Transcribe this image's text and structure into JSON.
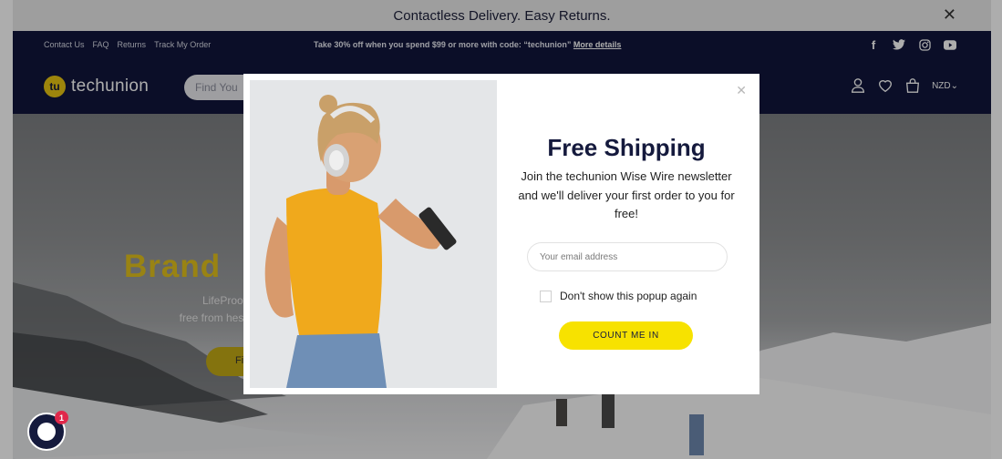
{
  "announcement": {
    "text": "Contactless Delivery. Easy Returns.",
    "close": "✕"
  },
  "utility_nav": {
    "links": [
      "Contact Us",
      "FAQ",
      "Returns",
      "Track My Order"
    ],
    "promo_text": "Take 30% off when you spend $99 or more with code: “techunion”",
    "promo_link": "More details",
    "social_icons": [
      "facebook-icon",
      "twitter-icon",
      "instagram-icon",
      "youtube-icon"
    ]
  },
  "header": {
    "logo_mark": "tu",
    "logo_text": "techunion",
    "search_placeholder": "Find You",
    "currency": "NZD⌄"
  },
  "hero": {
    "title": "Brand",
    "subtitle_line1": "LifeProof",
    "subtitle_line2": "free from hesi",
    "button_label": "Fi"
  },
  "modal": {
    "close": "✕",
    "title": "Free Shipping",
    "description": "Join the techunion Wise Wire newsletter and we'll deliver your first order to you for free!",
    "email_placeholder": "Your email address",
    "checkbox_label": "Don't show this popup again",
    "cta_label": "COUNT ME IN"
  },
  "chat": {
    "badge_count": "1"
  },
  "colors": {
    "navy": "#11163b",
    "brand_yellow": "#f7e200",
    "hero_yellow": "#e2c21d",
    "badge_red": "#e0284a"
  }
}
